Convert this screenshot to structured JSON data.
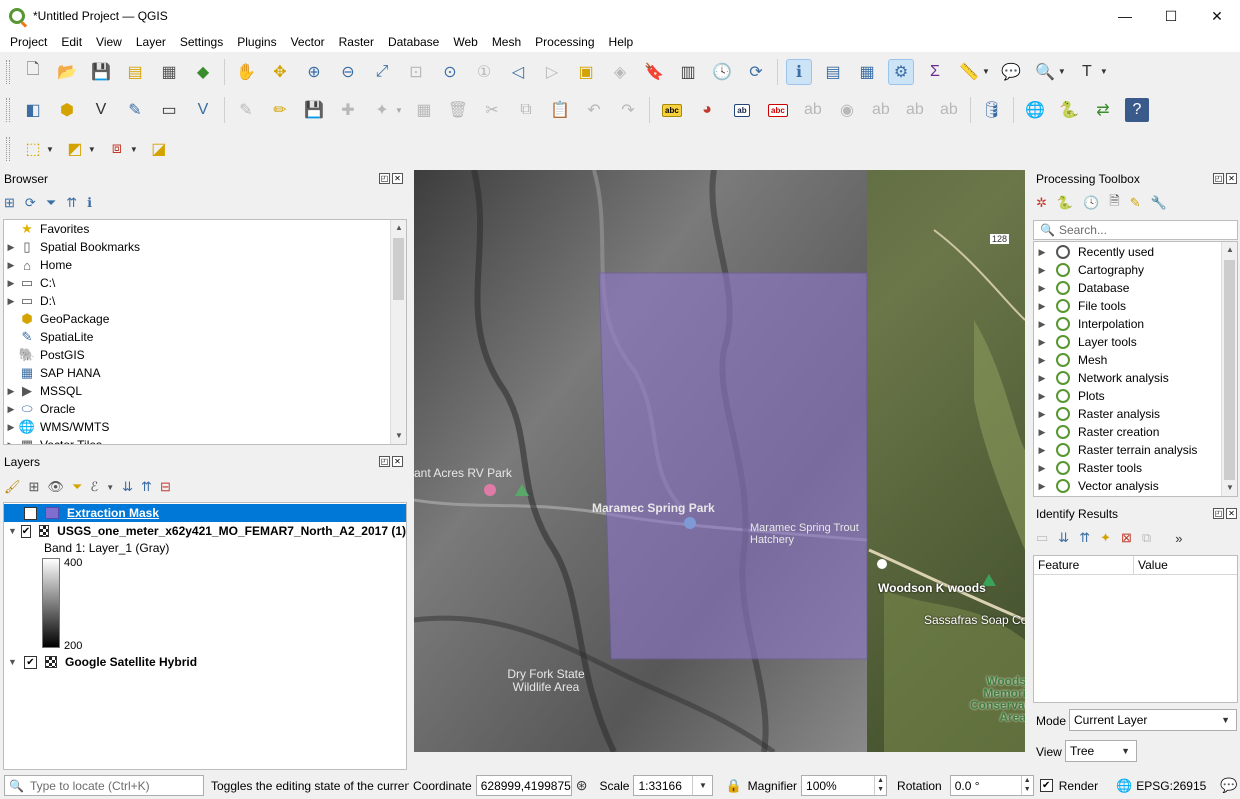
{
  "window": {
    "title": "*Untitled Project — QGIS",
    "minimize": "—",
    "maximize": "☐",
    "close": "✕"
  },
  "menu": [
    "Project",
    "Edit",
    "View",
    "Layer",
    "Settings",
    "Plugins",
    "Vector",
    "Raster",
    "Database",
    "Web",
    "Mesh",
    "Processing",
    "Help"
  ],
  "browser": {
    "title": "Browser",
    "items": [
      {
        "label": "Favorites",
        "icon": "star-icon"
      },
      {
        "label": "Spatial Bookmarks",
        "icon": "bookmark-icon"
      },
      {
        "label": "Home",
        "icon": "home-icon"
      },
      {
        "label": "C:\\",
        "icon": "drive-icon"
      },
      {
        "label": "D:\\",
        "icon": "drive-icon"
      },
      {
        "label": "GeoPackage",
        "icon": "geopackage-icon"
      },
      {
        "label": "SpatiaLite",
        "icon": "spatialite-icon"
      },
      {
        "label": "PostGIS",
        "icon": "postgis-icon"
      },
      {
        "label": "SAP HANA",
        "icon": "saphana-icon"
      },
      {
        "label": "MSSQL",
        "icon": "mssql-icon"
      },
      {
        "label": "Oracle",
        "icon": "oracle-icon"
      },
      {
        "label": "WMS/WMTS",
        "icon": "wms-icon"
      },
      {
        "label": "Vector Tiles",
        "icon": "vectortiles-icon"
      }
    ]
  },
  "layers": {
    "title": "Layers",
    "extraction_mask": "Extraction Mask",
    "usgs_layer": "USGS_one_meter_x62y421_MO_FEMAR7_North_A2_2017 (1)",
    "band": "Band 1: Layer_1 (Gray)",
    "ramp_max": "400",
    "ramp_min": "200",
    "google": "Google Satellite Hybrid"
  },
  "map": {
    "labels": {
      "rv_park": "ant Acres RV Park",
      "maramec": "Maramec Spring Park",
      "hatchery": "Maramec Spring Trout Hatchery",
      "dry_fork": "Dry Fork State Wildlife Area",
      "woodson": "Woodson K woods",
      "sassafras": "Sassafras Soap Co",
      "woods_mem": "Woods Memori Conservat Area",
      "route_128": "128"
    }
  },
  "processing": {
    "title": "Processing Toolbox",
    "search_placeholder": "Search...",
    "items": [
      "Recently used",
      "Cartography",
      "Database",
      "File tools",
      "Interpolation",
      "Layer tools",
      "Mesh",
      "Network analysis",
      "Plots",
      "Raster analysis",
      "Raster creation",
      "Raster terrain analysis",
      "Raster tools",
      "Vector analysis"
    ]
  },
  "identify": {
    "title": "Identify Results",
    "col_feature": "Feature",
    "col_value": "Value",
    "mode_label": "Mode",
    "mode_value": "Current Layer",
    "view_label": "View",
    "view_value": "Tree",
    "more": "»"
  },
  "status": {
    "locate_placeholder": "Type to locate (Ctrl+K)",
    "message": "Toggles the editing state of the current l",
    "coordinate_label": "Coordinate",
    "coordinate_value": "628999,4199875",
    "scale_label": "Scale",
    "scale_value": "1:33166",
    "magnifier_label": "Magnifier",
    "magnifier_value": "100%",
    "rotation_label": "Rotation",
    "rotation_value": "0.0 °",
    "render_label": "Render",
    "crs": "EPSG:26915"
  }
}
